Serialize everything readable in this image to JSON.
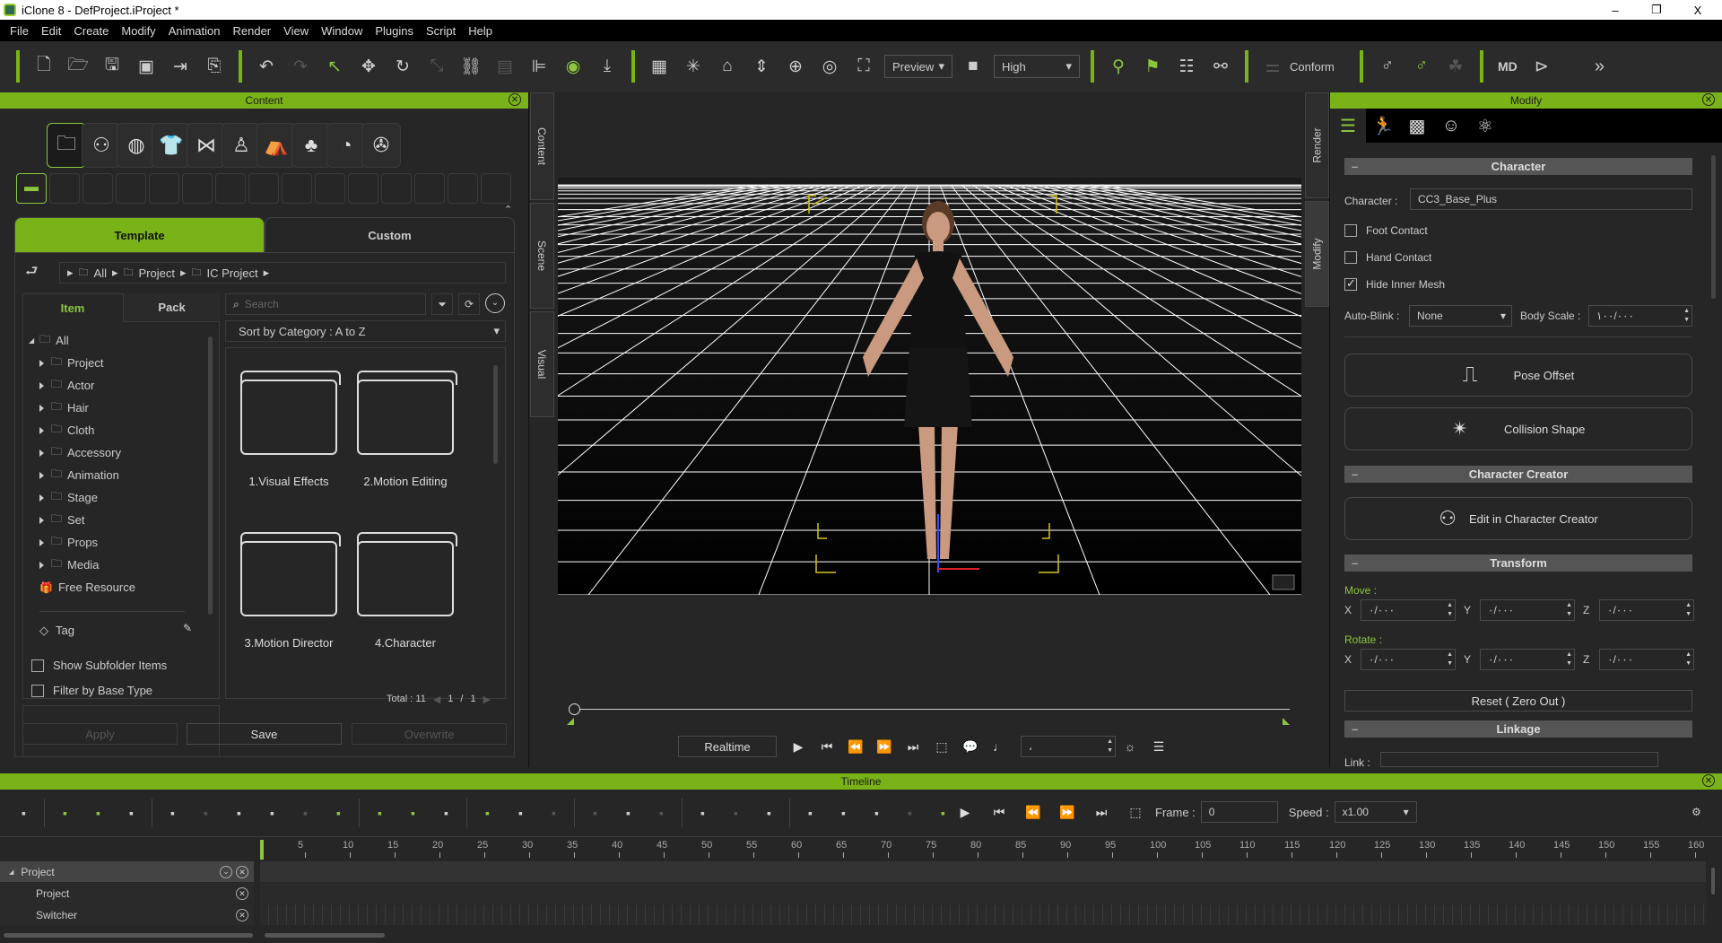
{
  "window": {
    "title": "iClone 8 - DefProject.iProject *",
    "min": "–",
    "max": "❐",
    "close": "X"
  },
  "menu": [
    "File",
    "Edit",
    "Create",
    "Modify",
    "Animation",
    "Render",
    "View",
    "Window",
    "Plugins",
    "Script",
    "Help"
  ],
  "toolbar": {
    "group1": [
      {
        "n": "new-file-icon",
        "g": "🗋"
      },
      {
        "n": "open-folder-icon",
        "g": "🗁"
      },
      {
        "n": "save-icon",
        "g": "🖫"
      },
      {
        "n": "pack-project-icon",
        "g": "▣"
      },
      {
        "n": "export-icon",
        "g": "⇥"
      },
      {
        "n": "export-usd-icon",
        "g": "⎘"
      }
    ],
    "group2": [
      {
        "n": "undo-icon",
        "g": "↶"
      },
      {
        "n": "redo-icon",
        "g": "↷",
        "d": 1
      },
      {
        "n": "select-icon",
        "g": "↖",
        "c": 1
      },
      {
        "n": "move-icon",
        "g": "✥"
      },
      {
        "n": "rotate-icon",
        "g": "↻"
      },
      {
        "n": "scale-icon",
        "g": "⤡",
        "d": 1
      },
      {
        "n": "pick-parent-icon",
        "g": "⛓"
      },
      {
        "n": "align-icon",
        "g": "▤",
        "d": 1
      },
      {
        "n": "attach-icon",
        "g": "⊫"
      },
      {
        "n": "visibility-eye-icon",
        "g": "◉",
        "c": 1
      },
      {
        "n": "drop-to-floor-icon",
        "g": "⤓"
      }
    ],
    "group3": [
      {
        "n": "layout-icon",
        "g": "▦"
      },
      {
        "n": "light-icon",
        "g": "✳"
      },
      {
        "n": "home-camera-icon",
        "g": "⌂"
      },
      {
        "n": "fit-view-icon",
        "g": "⇕"
      },
      {
        "n": "pan-icon",
        "g": "⊕"
      },
      {
        "n": "orbit-icon",
        "g": "◎"
      },
      {
        "n": "zoom-extents-icon",
        "g": "⛶"
      }
    ],
    "preview_label": "Preview",
    "quality_label": "High",
    "group4": [
      {
        "n": "motion-pose-icon",
        "g": "⚲",
        "c": 1
      },
      {
        "n": "flag-icon",
        "g": "⚑",
        "c": 1
      },
      {
        "n": "list-settings-icon",
        "g": "☷"
      },
      {
        "n": "link-node-icon",
        "g": "⚯"
      }
    ],
    "conform_label": "Conform",
    "group5": [
      {
        "n": "gender-icon",
        "g": "♂"
      },
      {
        "n": "gender-eye-icon",
        "g": "♂",
        "c": 1
      },
      {
        "n": "atom-cluster-icon",
        "g": "☘",
        "d": 1
      }
    ],
    "group6": [
      {
        "n": "md-logo-icon",
        "g": "MD"
      },
      {
        "n": "play-circle-icon",
        "g": "⊳"
      }
    ],
    "more": "»"
  },
  "content": {
    "title": "Content",
    "categories": [
      {
        "n": "folder-icon",
        "g": "🗀"
      },
      {
        "n": "actor-icon",
        "g": "⚇"
      },
      {
        "n": "hair-icon",
        "g": "◍"
      },
      {
        "n": "cloth-icon",
        "g": "👕"
      },
      {
        "n": "accessory-icon",
        "g": "⋈"
      },
      {
        "n": "animation-icon",
        "g": "♙"
      },
      {
        "n": "stage-icon",
        "g": "⛺"
      },
      {
        "n": "set-tree-icon",
        "g": "♣"
      },
      {
        "n": "props-icon",
        "g": "◔"
      },
      {
        "n": "media-film-icon",
        "g": "✇"
      }
    ],
    "tabs": {
      "template": "Template",
      "custom": "Custom"
    },
    "breadcrumb": [
      "All",
      "Project",
      "IC Project"
    ],
    "subtabs": {
      "item": "Item",
      "pack": "Pack"
    },
    "search_placeholder": "Search",
    "sort_label": "Sort by Category : A to Z",
    "tree": [
      "All",
      "Project",
      "Actor",
      "Hair",
      "Cloth",
      "Accessory",
      "Animation",
      "Stage",
      "Set",
      "Props",
      "Media",
      "Free Resource"
    ],
    "tag_label": "Tag",
    "show_subfolder": "Show Subfolder Items",
    "filter_base": "Filter by Base Type",
    "folders": [
      "1.Visual Effects",
      "2.Motion Editing",
      "3.Motion Director",
      "4.Character"
    ],
    "total": "Total : 11",
    "page_current": "1",
    "page_sep": "/",
    "page_total": "1",
    "buttons": {
      "apply": "Apply",
      "save": "Save",
      "overwrite": "Overwrite"
    }
  },
  "side_tabs_left": [
    "Content",
    "Scene",
    "Visual"
  ],
  "side_tabs_right": [
    "Render",
    "Modify"
  ],
  "viewport": {
    "realtime": "Realtime",
    "frame_field": "،"
  },
  "modify": {
    "title": "Modify",
    "character_section": "Character",
    "character_label": "Character :",
    "character_value": "CC3_Base_Plus",
    "foot_contact": "Foot Contact",
    "hand_contact": "Hand Contact",
    "hide_inner_mesh": "Hide Inner Mesh",
    "foot_checked": false,
    "hand_checked": false,
    "hide_checked": true,
    "auto_blink_label": "Auto-Blink :",
    "auto_blink_value": "None",
    "body_scale_label": "Body Scale :",
    "body_scale_value": "١٠٠/٠٠٠",
    "pose_offset": "Pose Offset",
    "collision_shape": "Collision Shape",
    "cc_section": "Character Creator",
    "edit_cc": "Edit in Character Creator",
    "transform_section": "Transform",
    "move_label": "Move :",
    "rotate_label": "Rotate :",
    "axes": [
      "X",
      "Y",
      "Z"
    ],
    "zero_value": "٠/٠٠٠",
    "reset": "Reset ( Zero Out )",
    "linkage_section": "Linkage",
    "link_label": "Link :"
  },
  "timeline": {
    "title": "Timeline",
    "frame_label": "Frame :",
    "frame_value": "0",
    "speed_label": "Speed :",
    "speed_value": "x1.00",
    "ruler": [
      "5",
      "10",
      "15",
      "20",
      "25",
      "30",
      "35",
      "40",
      "45",
      "50",
      "55",
      "60",
      "65",
      "70",
      "75",
      "80",
      "85",
      "90",
      "95",
      "100",
      "105",
      "110",
      "115",
      "120",
      "125",
      "130",
      "135",
      "140",
      "145",
      "150",
      "155",
      "160"
    ],
    "tracks": [
      "Project",
      "Project",
      "Switcher"
    ]
  },
  "colors": {
    "accent": "#7ab317",
    "panel": "#262626"
  }
}
